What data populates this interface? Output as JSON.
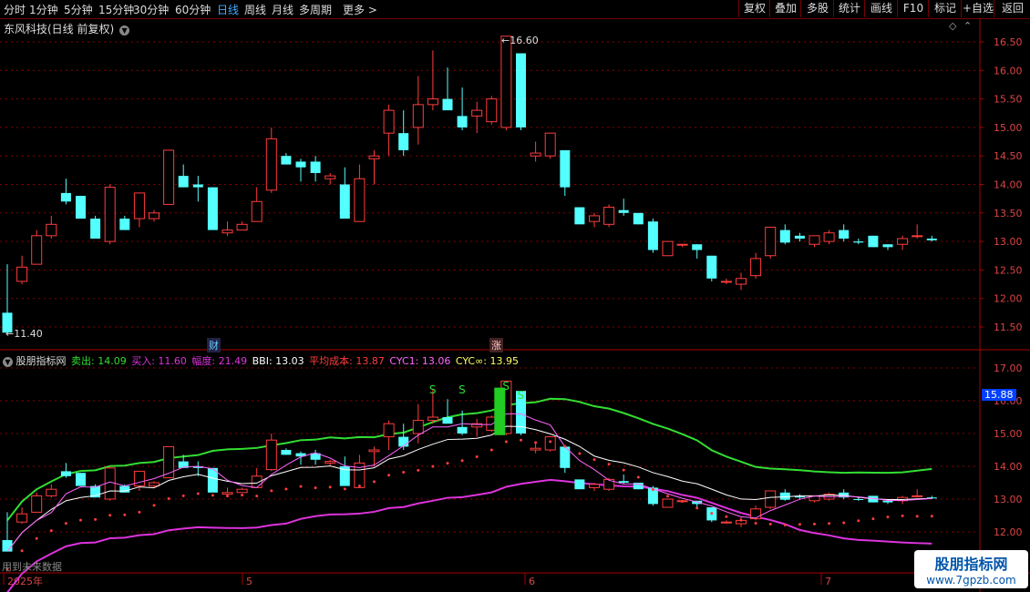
{
  "toolbar": {
    "left": [
      "分时",
      "1分钟",
      "5分钟",
      "15分钟",
      "30分钟",
      "60分钟",
      "日线",
      "周线",
      "月线",
      "多周期",
      "更多 >"
    ],
    "active_index": 6,
    "right": [
      "复权",
      "叠加",
      "多股",
      "统计",
      "画线",
      "F10",
      "标记",
      "+自选",
      "返回"
    ]
  },
  "main_title": "东风科技(日线 前复权)",
  "max_label": "16.60",
  "min_label": "11.40",
  "markers": {
    "cai": "财",
    "zhang": "涨"
  },
  "indicator": {
    "name": "股朋指标网",
    "sell": "卖出: 14.09",
    "buy": "买入: 11.60",
    "range": "幅度: 21.49",
    "bbi": "BBI: 13.03",
    "avg_cost": "平均成本: 13.87",
    "cyc1": "CYC1: 13.06",
    "cyc_inf": "CYC∞: 13.95",
    "s_mark": "S",
    "current_value": "15.88"
  },
  "upper_axis": [
    "16.50",
    "16.00",
    "15.50",
    "15.00",
    "14.50",
    "14.00",
    "13.50",
    "13.00",
    "12.50",
    "12.00",
    "11.50"
  ],
  "lower_axis": [
    "17.00",
    "16.00",
    "15.00",
    "14.00",
    "13.00",
    "12.00"
  ],
  "date_axis": [
    "2025年",
    "5",
    "6",
    "7"
  ],
  "note": "用到未来数据",
  "watermark": {
    "line1": "股朋指标网",
    "line2": "www.7gpzb.com"
  },
  "colors": {
    "up": "#ff3c3c",
    "down": "#54ffff",
    "sell_line": "#33dd33",
    "buy_line": "#dd33dd",
    "bbi": "#ffffff",
    "cyc1": "#ff66ff",
    "grid": "#8b0000"
  },
  "chart_data": {
    "type": "candlestick",
    "ohlc": [
      [
        11.75,
        12.6,
        11.45,
        11.4
      ],
      [
        12.3,
        12.75,
        12.25,
        12.55
      ],
      [
        12.6,
        13.2,
        12.6,
        13.1
      ],
      [
        13.1,
        13.45,
        13.05,
        13.3
      ],
      [
        13.85,
        14.1,
        13.65,
        13.7
      ],
      [
        13.8,
        13.8,
        13.45,
        13.4
      ],
      [
        13.4,
        13.45,
        13.05,
        13.05
      ],
      [
        13.0,
        14.0,
        12.95,
        13.95
      ],
      [
        13.4,
        13.45,
        13.25,
        13.2
      ],
      [
        13.4,
        13.85,
        13.25,
        13.85
      ],
      [
        13.4,
        13.55,
        13.35,
        13.5
      ],
      [
        13.65,
        14.6,
        13.65,
        14.6
      ],
      [
        14.15,
        14.35,
        13.95,
        13.95
      ],
      [
        14.0,
        14.15,
        13.7,
        13.95
      ],
      [
        13.95,
        13.95,
        13.25,
        13.2
      ],
      [
        13.15,
        13.35,
        13.1,
        13.2
      ],
      [
        13.2,
        13.35,
        13.2,
        13.3
      ],
      [
        13.35,
        13.95,
        13.35,
        13.7
      ],
      [
        13.9,
        15.0,
        13.85,
        14.8
      ],
      [
        14.5,
        14.55,
        14.35,
        14.35
      ],
      [
        14.4,
        14.45,
        14.05,
        14.3
      ],
      [
        14.4,
        14.5,
        14.05,
        14.2
      ],
      [
        14.1,
        14.2,
        14.0,
        14.15
      ],
      [
        14.0,
        14.3,
        13.5,
        13.4
      ],
      [
        13.35,
        14.35,
        13.35,
        14.1
      ],
      [
        14.45,
        14.6,
        14.0,
        14.5
      ],
      [
        14.9,
        15.4,
        14.5,
        15.3
      ],
      [
        14.9,
        15.3,
        14.5,
        14.6
      ],
      [
        15.0,
        15.9,
        14.7,
        15.4
      ],
      [
        15.4,
        16.35,
        15.3,
        15.5
      ],
      [
        15.5,
        16.05,
        15.35,
        15.3
      ],
      [
        15.2,
        15.7,
        14.95,
        15.0
      ],
      [
        15.2,
        15.45,
        14.9,
        15.3
      ],
      [
        15.1,
        15.55,
        15.05,
        15.5
      ],
      [
        15.0,
        16.6,
        14.95,
        16.6
      ],
      [
        16.3,
        16.3,
        14.95,
        15.0
      ],
      [
        14.5,
        14.75,
        14.4,
        14.55
      ],
      [
        14.5,
        14.9,
        14.45,
        14.9
      ],
      [
        14.6,
        14.6,
        13.8,
        13.95
      ],
      [
        13.6,
        13.6,
        13.4,
        13.3
      ],
      [
        13.35,
        13.5,
        13.25,
        13.45
      ],
      [
        13.3,
        13.65,
        13.25,
        13.6
      ],
      [
        13.55,
        13.75,
        13.45,
        13.5
      ],
      [
        13.5,
        13.5,
        13.3,
        13.3
      ],
      [
        13.35,
        13.4,
        12.8,
        12.85
      ],
      [
        12.75,
        13.0,
        12.75,
        13.0
      ],
      [
        12.95,
        12.95,
        12.9,
        12.95
      ],
      [
        12.95,
        12.95,
        12.7,
        12.85
      ],
      [
        12.75,
        12.75,
        12.3,
        12.35
      ],
      [
        12.3,
        12.35,
        12.25,
        12.3
      ],
      [
        12.25,
        12.45,
        12.15,
        12.35
      ],
      [
        12.4,
        12.8,
        12.35,
        12.7
      ],
      [
        12.75,
        13.25,
        12.7,
        13.25
      ],
      [
        13.2,
        13.3,
        12.95,
        12.98
      ],
      [
        13.1,
        13.15,
        13.0,
        13.05
      ],
      [
        12.95,
        13.1,
        12.9,
        13.1
      ],
      [
        13.0,
        13.2,
        12.95,
        13.15
      ],
      [
        13.2,
        13.3,
        13.0,
        13.05
      ],
      [
        13.0,
        13.05,
        12.95,
        12.98
      ],
      [
        13.1,
        13.1,
        12.9,
        12.9
      ],
      [
        12.95,
        12.95,
        12.85,
        12.9
      ],
      [
        12.95,
        13.1,
        12.85,
        13.05
      ],
      [
        13.1,
        13.3,
        13.05,
        13.1
      ],
      [
        13.05,
        13.1,
        13.0,
        13.02
      ]
    ]
  }
}
